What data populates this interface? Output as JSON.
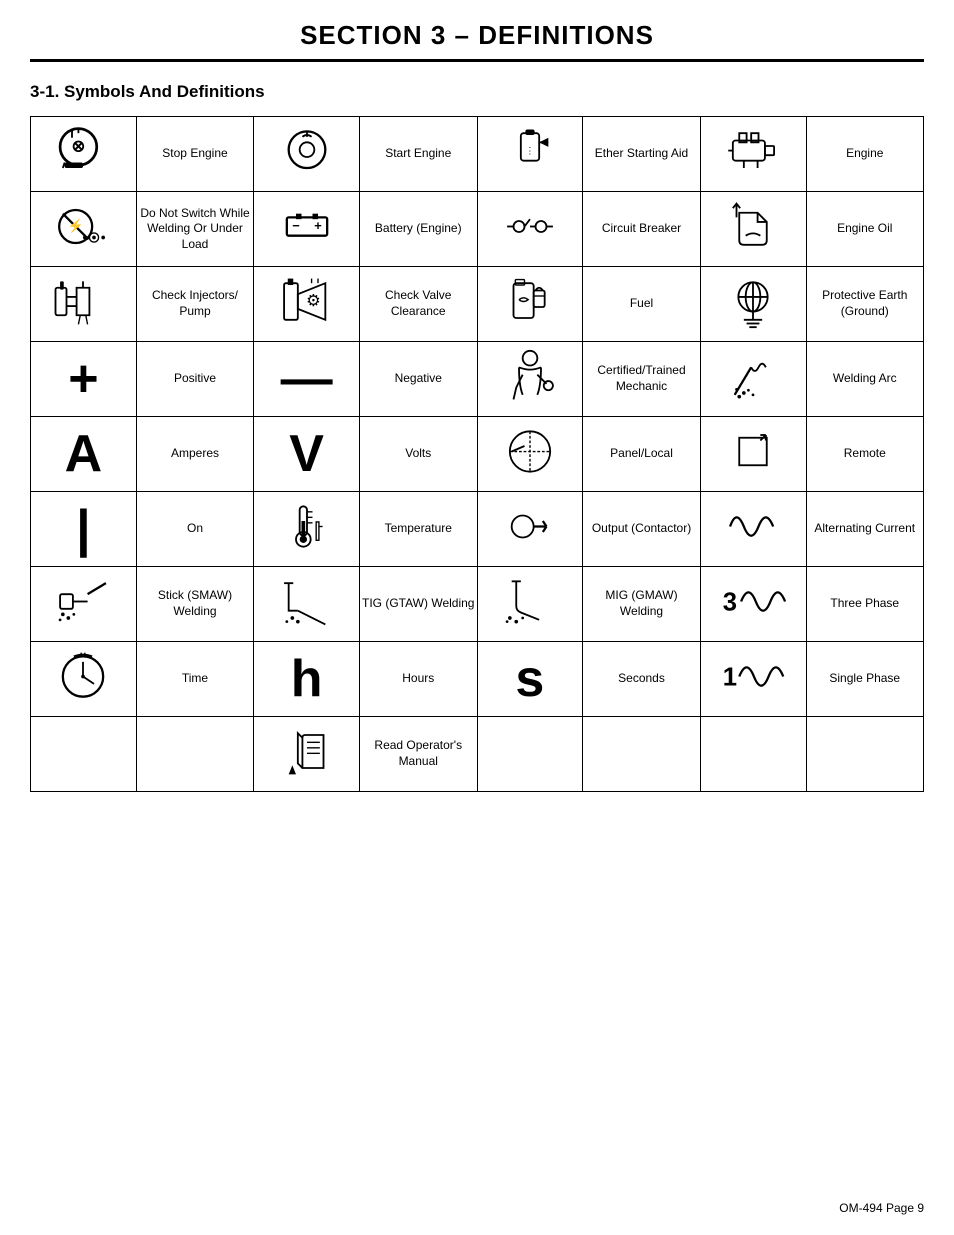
{
  "title": "SECTION 3 – DEFINITIONS",
  "section": "3-1.   Symbols And Definitions",
  "footer": "OM-494  Page 9",
  "rows": [
    {
      "cols": [
        {
          "type": "svg",
          "svg": "stop_engine",
          "label": "Stop Engine"
        },
        {
          "type": "svg",
          "svg": "start_engine",
          "label": "Start Engine"
        },
        {
          "type": "svg",
          "svg": "ether",
          "label": "Ether Starting Aid"
        },
        {
          "type": "svg",
          "svg": "engine",
          "label": "Engine"
        }
      ]
    },
    {
      "cols": [
        {
          "type": "svg",
          "svg": "no_switch",
          "label": "Do Not Switch While Welding Or Under Load"
        },
        {
          "type": "svg",
          "svg": "battery",
          "label": "Battery (Engine)"
        },
        {
          "type": "svg",
          "svg": "circuit_breaker",
          "label": "Circuit Breaker"
        },
        {
          "type": "svg",
          "svg": "engine_oil",
          "label": "Engine Oil"
        }
      ]
    },
    {
      "cols": [
        {
          "type": "svg",
          "svg": "check_injectors",
          "label": "Check Injectors/ Pump"
        },
        {
          "type": "svg",
          "svg": "check_valve",
          "label": "Check Valve Clearance"
        },
        {
          "type": "svg",
          "svg": "fuel",
          "label": "Fuel"
        },
        {
          "type": "svg",
          "svg": "protective_earth",
          "label": "Protective Earth (Ground)"
        }
      ]
    },
    {
      "cols": [
        {
          "type": "text",
          "text": "+",
          "label": "Positive"
        },
        {
          "type": "text",
          "text": "—",
          "label": "Negative"
        },
        {
          "type": "svg",
          "svg": "mechanic",
          "label": "Certified/Trained Mechanic"
        },
        {
          "type": "svg",
          "svg": "welding_arc",
          "label": "Welding Arc"
        }
      ]
    },
    {
      "cols": [
        {
          "type": "text",
          "text": "A",
          "label": "Amperes"
        },
        {
          "type": "text",
          "text": "V",
          "label": "Volts"
        },
        {
          "type": "svg",
          "svg": "panel_local",
          "label": "Panel/Local"
        },
        {
          "type": "svg",
          "svg": "remote",
          "label": "Remote"
        }
      ]
    },
    {
      "cols": [
        {
          "type": "text",
          "text": "|",
          "label": "On"
        },
        {
          "type": "svg",
          "svg": "temperature",
          "label": "Temperature"
        },
        {
          "type": "svg",
          "svg": "output_contactor",
          "label": "Output (Contactor)"
        },
        {
          "type": "svg",
          "svg": "ac",
          "label": "Alternating Current"
        }
      ]
    },
    {
      "cols": [
        {
          "type": "svg",
          "svg": "stick",
          "label": "Stick (SMAW) Welding"
        },
        {
          "type": "svg",
          "svg": "tig",
          "label": "TIG (GTAW) Welding"
        },
        {
          "type": "svg",
          "svg": "mig",
          "label": "MIG (GMAW) Welding"
        },
        {
          "type": "svg",
          "svg": "three_phase",
          "label": "Three Phase"
        }
      ]
    },
    {
      "cols": [
        {
          "type": "svg",
          "svg": "time",
          "label": "Time"
        },
        {
          "type": "text",
          "text": "h",
          "label": "Hours"
        },
        {
          "type": "text",
          "text": "s",
          "label": "Seconds"
        },
        {
          "type": "svg",
          "svg": "single_phase",
          "label": "Single Phase"
        }
      ]
    },
    {
      "cols": [
        {
          "type": "empty",
          "label": ""
        },
        {
          "type": "svg",
          "svg": "read_manual",
          "label": "Read Operator's Manual"
        },
        {
          "type": "empty",
          "label": ""
        },
        {
          "type": "empty",
          "label": ""
        }
      ]
    }
  ]
}
